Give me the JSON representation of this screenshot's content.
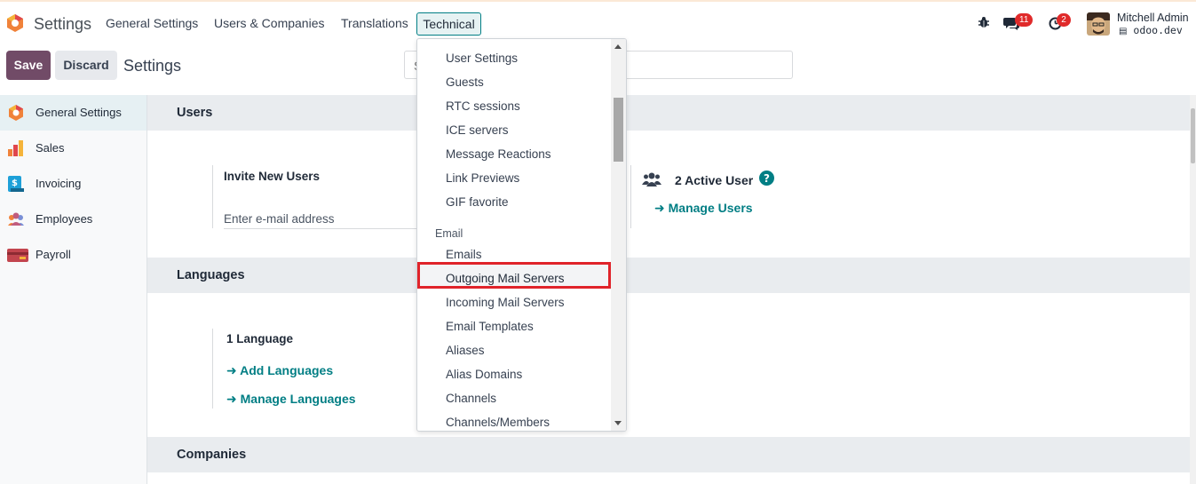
{
  "app": {
    "title": "Settings",
    "menu": [
      "General Settings",
      "Users & Companies",
      "Translations",
      "Technical"
    ],
    "chat_badge": "11",
    "activity_badge": "2",
    "user_name": "Mitchell Admin",
    "database": "odoo.dev"
  },
  "control_panel": {
    "save_label": "Save",
    "discard_label": "Discard",
    "breadcrumb": "Settings",
    "search_placeholder": "Search..."
  },
  "sidebar": {
    "items": [
      {
        "label": "General Settings",
        "icon": "odoo-logo-icon",
        "active": true
      },
      {
        "label": "Sales",
        "icon": "sales-icon"
      },
      {
        "label": "Invoicing",
        "icon": "invoicing-icon"
      },
      {
        "label": "Employees",
        "icon": "employees-icon"
      },
      {
        "label": "Payroll",
        "icon": "payroll-icon"
      }
    ]
  },
  "sections": {
    "users": {
      "title": "Users",
      "invite_title": "Invite New Users",
      "email_placeholder": "Enter e-mail address",
      "active_users": "2 Active User",
      "manage_users": "Manage Users"
    },
    "languages": {
      "title": "Languages",
      "count": "1 Language",
      "add_languages": "Add Languages",
      "manage_languages": "Manage Languages"
    },
    "companies": {
      "title": "Companies"
    }
  },
  "dropdown": {
    "items_before": [
      "User Settings",
      "Guests",
      "RTC sessions",
      "ICE servers",
      "Message Reactions",
      "Link Previews",
      "GIF favorite"
    ],
    "email_header": "Email",
    "items_email": [
      "Emails",
      "Outgoing Mail Servers",
      "Incoming Mail Servers",
      "Email Templates",
      "Aliases",
      "Alias Domains",
      "Channels",
      "Channels/Members"
    ],
    "highlighted": "Outgoing Mail Servers"
  },
  "colors": {
    "primary": "#714b67",
    "accent": "#017e84",
    "highlight_border": "#e0232a",
    "badge": "#e02a2a"
  }
}
